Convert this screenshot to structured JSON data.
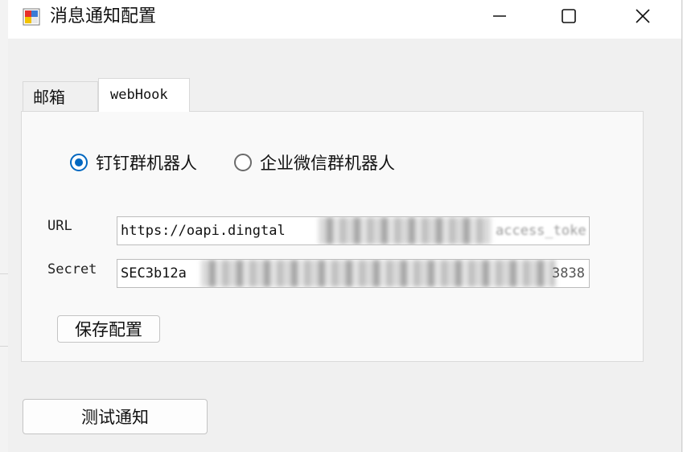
{
  "window": {
    "title": "消息通知配置"
  },
  "tabs": [
    {
      "label": "邮箱",
      "active": false
    },
    {
      "label": "webHook",
      "active": true
    }
  ],
  "webhook": {
    "radio_dingtalk": {
      "label": "钉钉群机器人",
      "checked": true
    },
    "radio_wecom": {
      "label": "企业微信群机器人",
      "checked": false
    },
    "url_label": "URL",
    "url_value": "https://oapi.dingtal",
    "url_tail": "access_toke",
    "secret_label": "Secret",
    "secret_value": "SEC3b12a",
    "secret_tail": "3838",
    "save_button": "保存配置"
  },
  "test_button": "测试通知",
  "colors": {
    "accent": "#0067c0",
    "window_bg": "#f0f0f0"
  }
}
